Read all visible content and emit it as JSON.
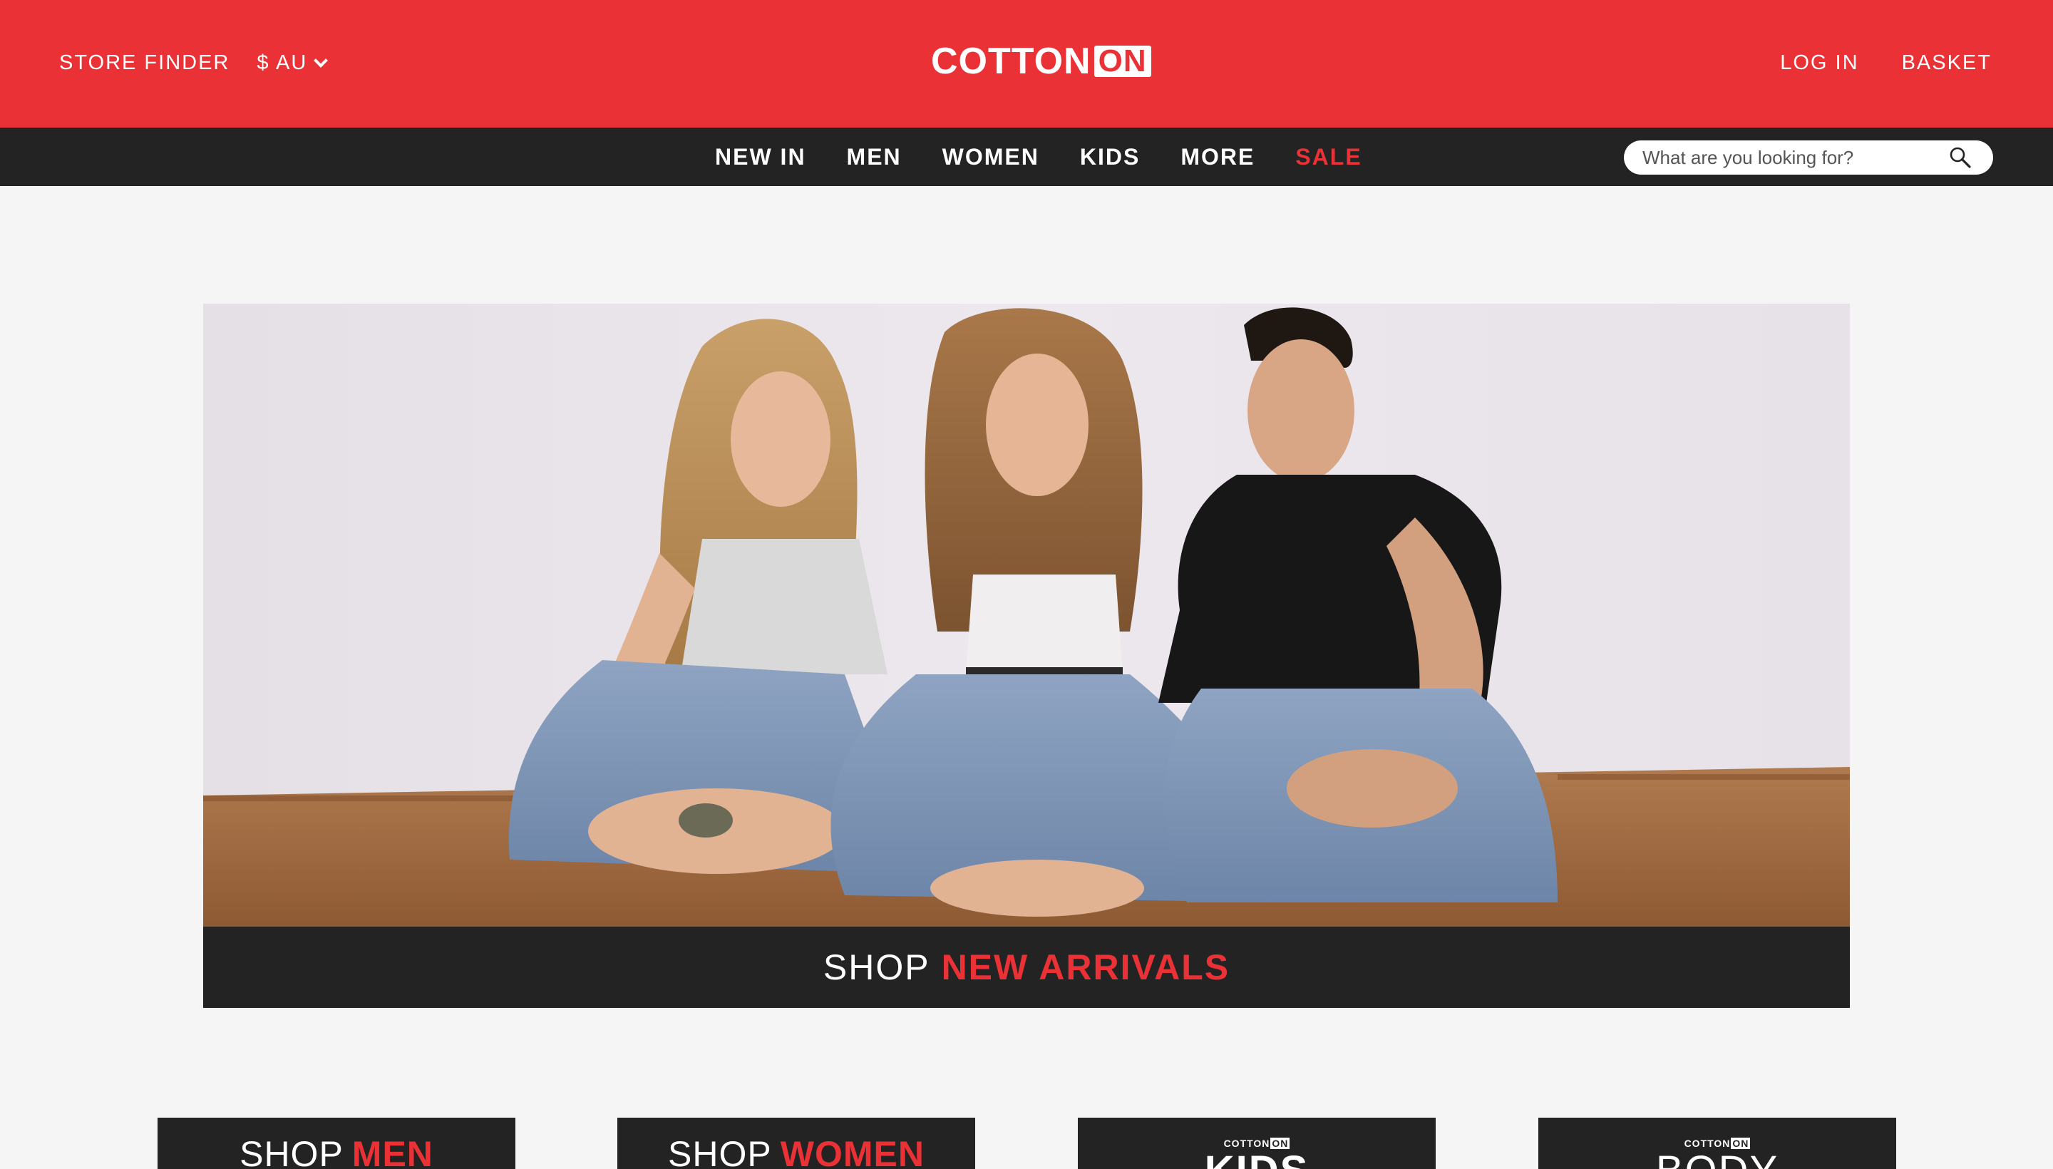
{
  "header": {
    "store_finder": "STORE FINDER",
    "currency": "$ AU",
    "logo_word": "COTTON",
    "logo_on": "ON",
    "log_in": "LOG IN",
    "basket": "BASKET"
  },
  "nav": {
    "items": [
      {
        "label": "NEW IN"
      },
      {
        "label": "MEN"
      },
      {
        "label": "WOMEN"
      },
      {
        "label": "KIDS"
      },
      {
        "label": "MORE"
      },
      {
        "label": "SALE"
      }
    ]
  },
  "search": {
    "placeholder": "What are you looking for?",
    "icon": "search-icon"
  },
  "hero": {
    "caption_prefix": "SHOP",
    "caption_highlight": "NEW ARRIVALS"
  },
  "tiles": [
    {
      "prefix": "SHOP",
      "highlight": "MEN"
    },
    {
      "prefix": "SHOP",
      "highlight": "WOMEN"
    },
    {
      "mini": "COTTON",
      "mini_on": "ON",
      "big": "KIDS"
    },
    {
      "mini": "COTTON",
      "mini_on": "ON",
      "big": "BODY"
    }
  ],
  "colors": {
    "brand_red": "#ea3236",
    "nav_dark": "#232323",
    "page_bg": "#f5f5f5"
  }
}
